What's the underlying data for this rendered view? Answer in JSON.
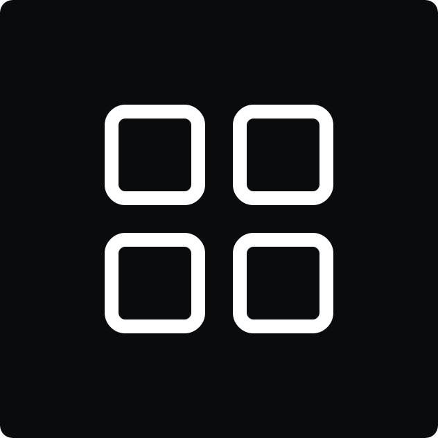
{
  "icon": {
    "name": "app-grid-icon",
    "background_color": "#0a0b0d",
    "stroke_color": "#ffffff"
  }
}
